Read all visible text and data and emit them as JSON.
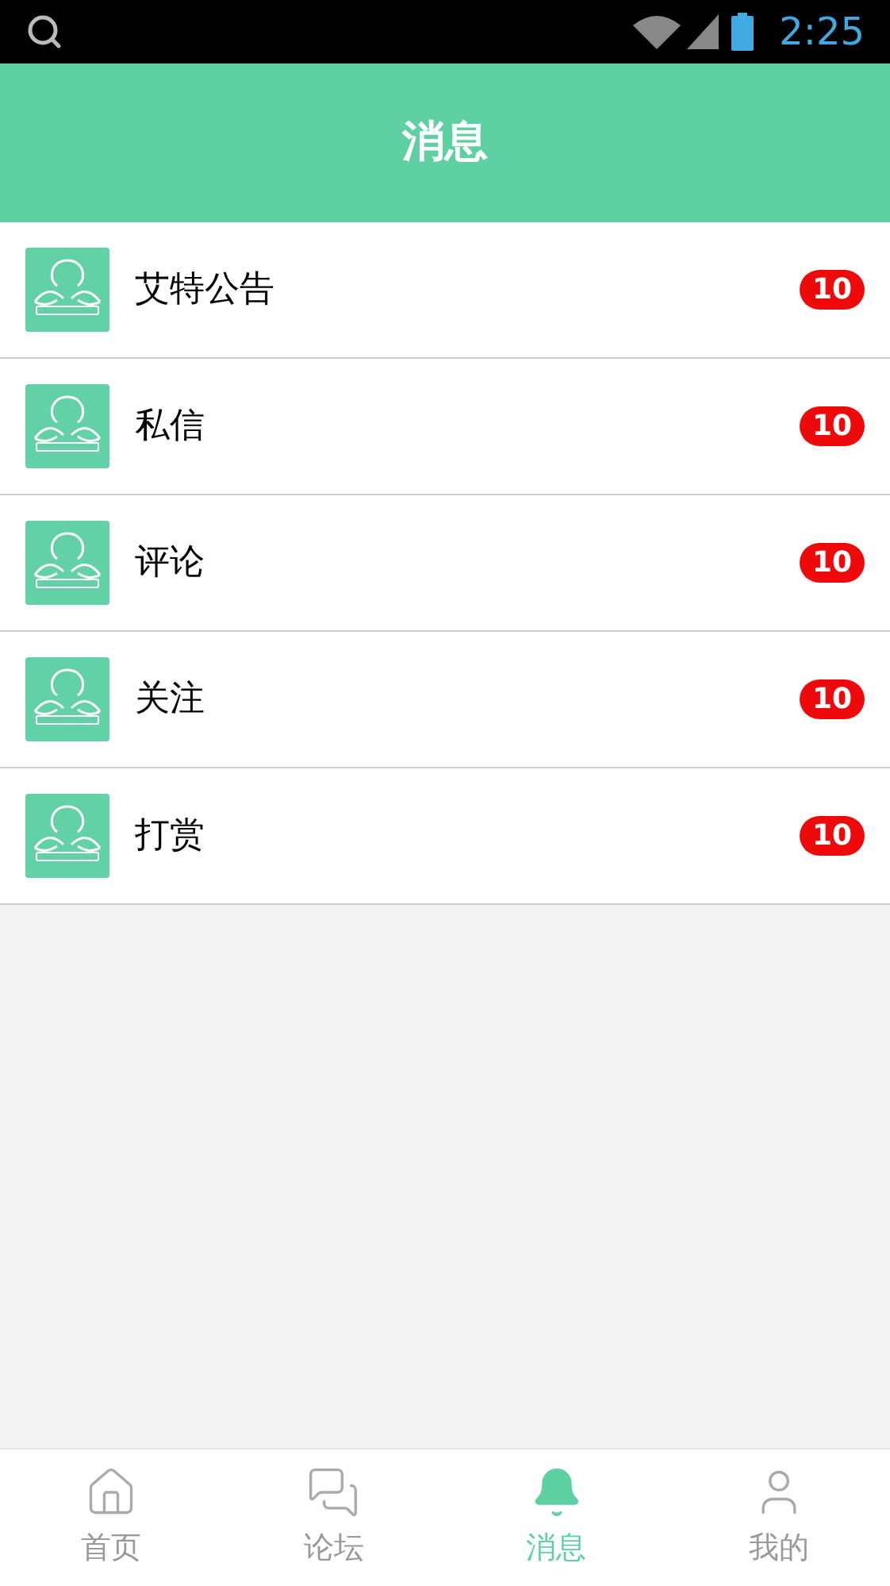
{
  "status_bar": {
    "time": "2:25"
  },
  "header": {
    "title": "消息"
  },
  "messages": [
    {
      "title": "艾特公告",
      "badge": "10"
    },
    {
      "title": "私信",
      "badge": "10"
    },
    {
      "title": "评论",
      "badge": "10"
    },
    {
      "title": "关注",
      "badge": "10"
    },
    {
      "title": "打赏",
      "badge": "10"
    }
  ],
  "tabs": [
    {
      "kind": "home",
      "label": "首页",
      "selected": false
    },
    {
      "kind": "forum",
      "label": "论坛",
      "selected": false
    },
    {
      "kind": "messages",
      "label": "消息",
      "selected": true
    },
    {
      "kind": "profile",
      "label": "我的",
      "selected": false
    }
  ]
}
